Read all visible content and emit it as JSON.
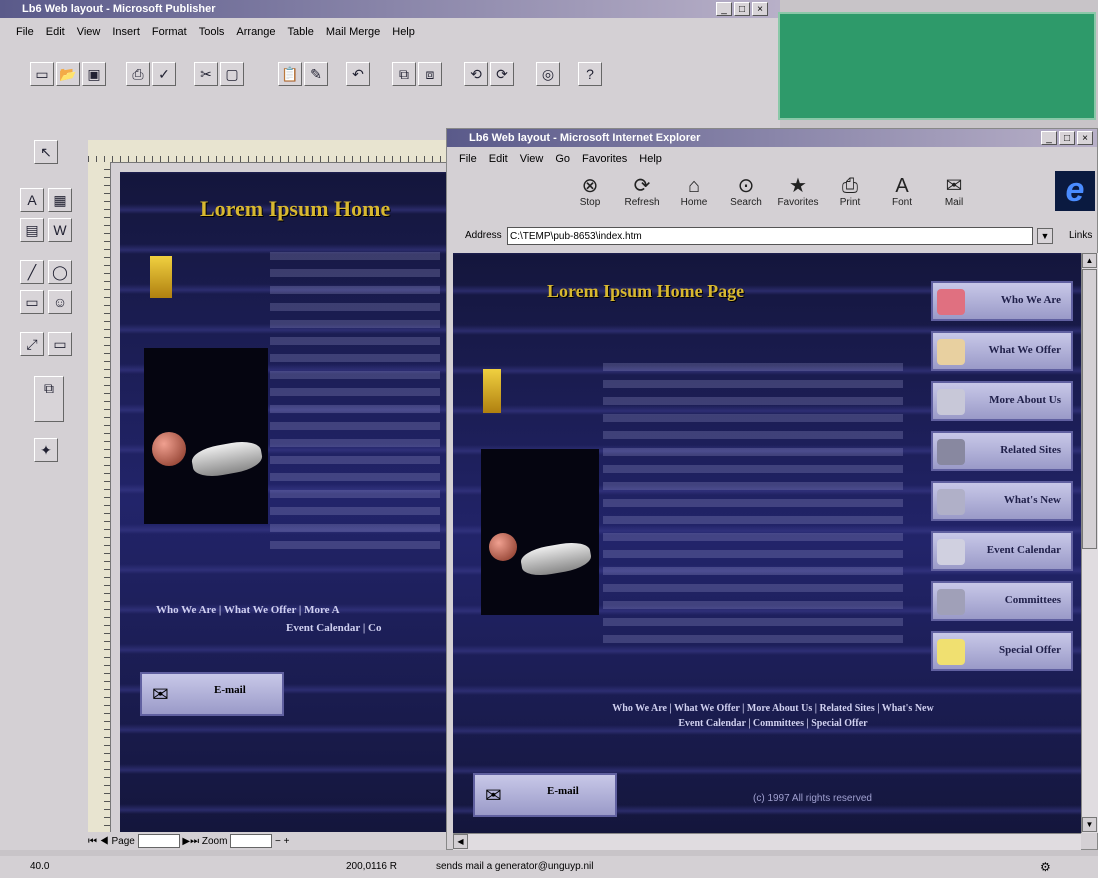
{
  "publisher": {
    "title": "Lb6 Web layout - Microsoft Publisher",
    "menu": [
      "File",
      "Edit",
      "View",
      "Insert",
      "Format",
      "Tools",
      "Arrange",
      "Table",
      "Mail Merge",
      "Help"
    ],
    "page_heading": "Lorem Ipsum Home",
    "nav_links_row1": [
      "Who We Are",
      "What We Offer",
      "More A"
    ],
    "nav_links_row2": [
      "Event Calendar",
      "Co"
    ],
    "email_label": "E-mail",
    "bottom_bar": {
      "page_label": "Page",
      "zoom_label": "Zoom"
    },
    "status": {
      "left": "40.0",
      "coords": "200,0116 R",
      "center": "sends mail a generator@unguyp.nil"
    }
  },
  "ie": {
    "title": "Lb6 Web layout - Microsoft Internet Explorer",
    "menu": [
      "File",
      "Edit",
      "View",
      "Go",
      "Favorites",
      "Help"
    ],
    "toolbar": [
      {
        "label": "Stop",
        "icon": "stop-icon",
        "glyph": "⊗"
      },
      {
        "label": "Refresh",
        "icon": "refresh-icon",
        "glyph": "⟳"
      },
      {
        "label": "Home",
        "icon": "home-icon",
        "glyph": "⌂"
      },
      {
        "label": "Search",
        "icon": "search-icon",
        "glyph": "⊙"
      },
      {
        "label": "Favorites",
        "icon": "favorites-icon",
        "glyph": "★"
      },
      {
        "label": "Print",
        "icon": "print-icon",
        "glyph": "⎙"
      },
      {
        "label": "Font",
        "icon": "font-icon",
        "glyph": "A"
      },
      {
        "label": "Mail",
        "icon": "mail-icon",
        "glyph": "✉"
      }
    ],
    "address_label": "Address",
    "address_value": "C:\\TEMP\\pub-8653\\index.htm",
    "links_label": "Links",
    "page_heading": "Lorem Ipsum Home Page",
    "sidebar": [
      "Who We Are",
      "What We Offer",
      "More About Us",
      "Related Sites",
      "What's New",
      "Event Calendar",
      "Committees",
      "Special Offer"
    ],
    "footer_row1": [
      "Who We Are",
      "What We Offer",
      "More About Us",
      "Related Sites",
      "What's New"
    ],
    "footer_row2": [
      "Event Calendar",
      "Committees",
      "Special Offer"
    ],
    "email_label": "E-mail",
    "copyright": "(c) 1997 All rights reserved"
  },
  "colors": {
    "title_gold": "#d8b830",
    "page_dark": "#14163c",
    "green_panel": "#2e9a6a"
  }
}
